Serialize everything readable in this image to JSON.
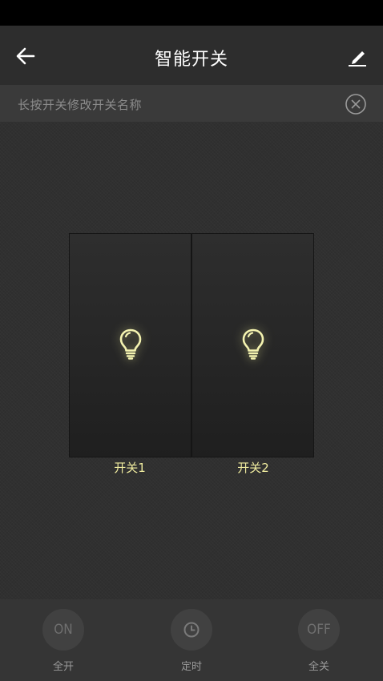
{
  "header": {
    "title": "智能开关",
    "back_icon": "arrow-left-icon",
    "edit_icon": "pencil-icon"
  },
  "hint": {
    "text": "长按开关修改开关名称",
    "close_icon": "close-circle-icon"
  },
  "switches": [
    {
      "label": "开关1",
      "icon": "lightbulb-icon"
    },
    {
      "label": "开关2",
      "icon": "lightbulb-icon"
    }
  ],
  "bottom": {
    "all_on": {
      "text": "ON",
      "label": "全开"
    },
    "timer": {
      "icon": "clock-icon",
      "label": "定时"
    },
    "all_off": {
      "text": "OFF",
      "label": "全关"
    }
  },
  "colors": {
    "bulb_glow": "#f0f0a0",
    "switch_label": "#eeea9e"
  }
}
